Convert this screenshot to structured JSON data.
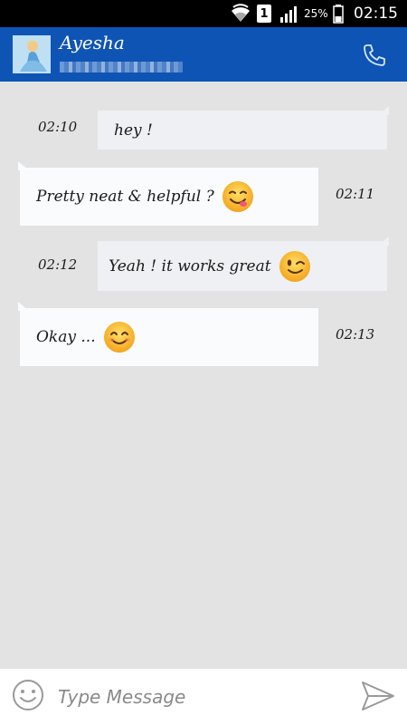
{
  "status_bar": {
    "time": "02:15",
    "battery_percent": "25%",
    "sim_slot": "1",
    "icons": [
      "wifi-icon",
      "sim-icon",
      "signal-icon",
      "battery-icon"
    ]
  },
  "header": {
    "contact_name": "Ayesha",
    "avatar": "avatar-princess",
    "call_icon": "phone-icon",
    "color": "#0d54b5"
  },
  "messages": [
    {
      "direction": "outgoing",
      "text": "hey !",
      "time": "02:10",
      "emoji": null
    },
    {
      "direction": "incoming",
      "text": "Pretty neat & helpful ?",
      "time": "02:11",
      "emoji": "yum-face"
    },
    {
      "direction": "outgoing",
      "text": "Yeah ! it works great",
      "time": "02:12",
      "emoji": "winking-face"
    },
    {
      "direction": "incoming",
      "text": "Okay ...",
      "time": "02:13",
      "emoji": "smiling-face"
    }
  ],
  "composer": {
    "placeholder": "Type Message",
    "value": "",
    "smiley_icon": "smiley-icon",
    "send_icon": "send-icon"
  }
}
